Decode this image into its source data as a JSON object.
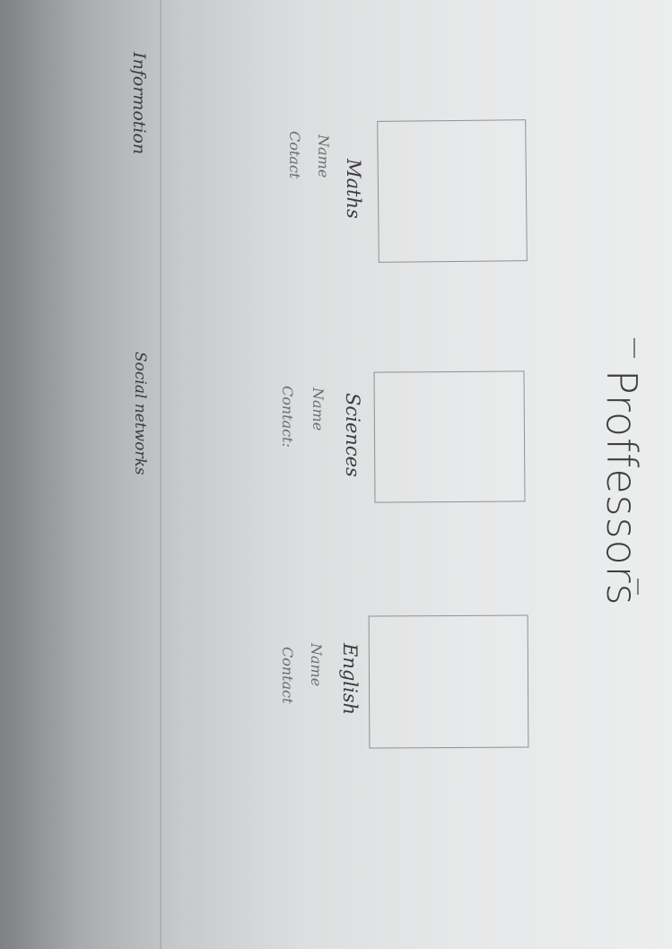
{
  "page": {
    "title": "Proffessors"
  },
  "cards": [
    {
      "subject": "Maths",
      "name_label": "Name",
      "contact_label": "Cotact"
    },
    {
      "subject": "Sciences",
      "name_label": "Name",
      "contact_label": "Contact:"
    },
    {
      "subject": "English",
      "name_label": "Name",
      "contact_label": "Contact"
    }
  ],
  "footer": {
    "information": "Informotion",
    "social": "Social networks"
  }
}
